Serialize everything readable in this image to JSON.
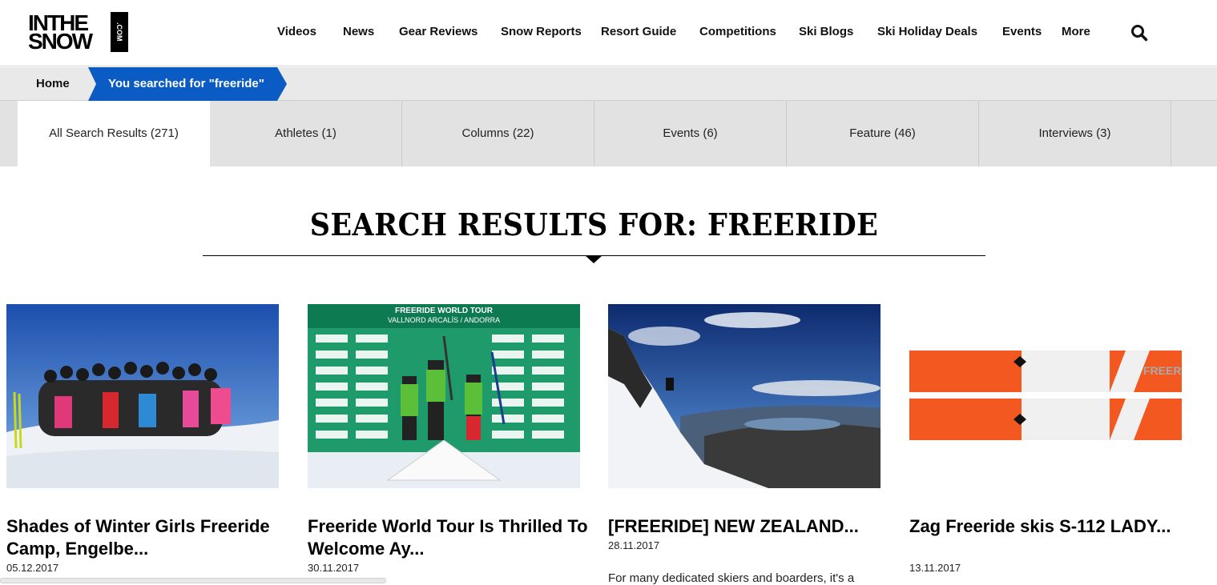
{
  "site": {
    "logo_line1": "INTHE",
    "logo_line2": "SNOW",
    "logo_suffix": ".COM"
  },
  "nav": {
    "items": [
      "Videos",
      "News",
      "Gear Reviews",
      "Snow Reports",
      "Resort Guide",
      "Competitions",
      "Ski Blogs",
      "Ski Holiday Deals",
      "Events",
      "More"
    ],
    "search_icon": "search-icon"
  },
  "breadcrumb": {
    "home": "Home",
    "current": "You searched for \"freeride\""
  },
  "tabs": [
    {
      "label": "All Search Results (271)",
      "active": true
    },
    {
      "label": "Athletes (1)",
      "active": false
    },
    {
      "label": "Columns (22)",
      "active": false
    },
    {
      "label": "Events (6)",
      "active": false
    },
    {
      "label": "Feature (46)",
      "active": false
    },
    {
      "label": "Interviews (3)",
      "active": false
    }
  ],
  "page": {
    "title": "SEARCH RESULTS FOR: FREERIDE"
  },
  "results": [
    {
      "title": "Shades of Winter Girls Freeride Camp, Engelbe...",
      "date": "05.12.2017",
      "excerpt": ""
    },
    {
      "title": "Freeride World Tour Is Thrilled To Welcome Ay...",
      "date": "30.11.2017",
      "excerpt": ""
    },
    {
      "title": "[FREERIDE] NEW ZEALAND...",
      "date": "28.11.2017",
      "excerpt": "For many dedicated skiers and boarders, it's a"
    },
    {
      "title": "Zag Freeride skis S-112 LADY...",
      "date": "13.11.2017",
      "excerpt": ""
    }
  ],
  "image_text": {
    "fwt_banner": "FREERIDE WORLD TOUR",
    "fwt_location": "VALLNORD ARCALÍS / ANDORRA",
    "ski_brand": "FREERI"
  },
  "colors": {
    "accent_blue": "#0a5bc4",
    "breadcrumb_bg": "#e9e9e9",
    "tabs_bg": "#e2e2e2",
    "ski_orange": "#f2581f"
  }
}
